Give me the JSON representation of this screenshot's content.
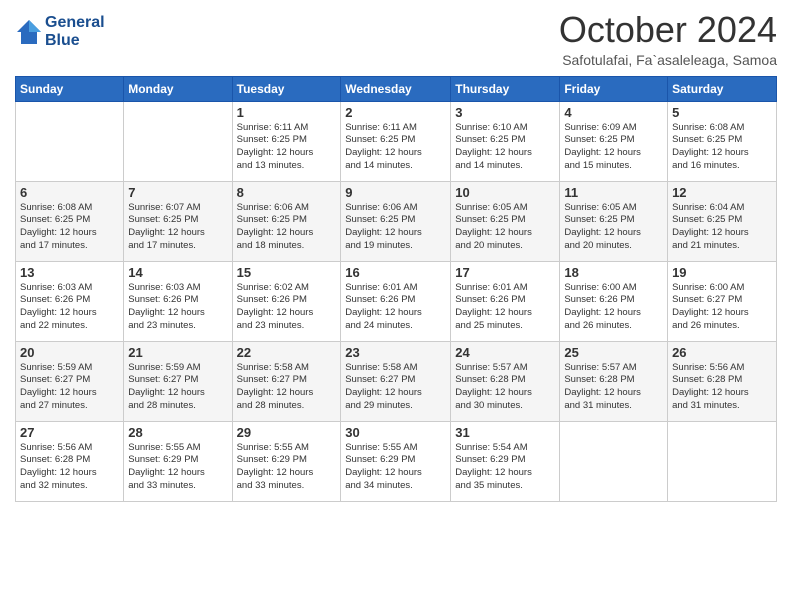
{
  "header": {
    "logo_line1": "General",
    "logo_line2": "Blue",
    "title": "October 2024",
    "location": "Safotulafai, Fa`asaleleaga, Samoa"
  },
  "weekdays": [
    "Sunday",
    "Monday",
    "Tuesday",
    "Wednesday",
    "Thursday",
    "Friday",
    "Saturday"
  ],
  "weeks": [
    [
      {
        "day": "",
        "info": ""
      },
      {
        "day": "",
        "info": ""
      },
      {
        "day": "1",
        "info": "Sunrise: 6:11 AM\nSunset: 6:25 PM\nDaylight: 12 hours\nand 13 minutes."
      },
      {
        "day": "2",
        "info": "Sunrise: 6:11 AM\nSunset: 6:25 PM\nDaylight: 12 hours\nand 14 minutes."
      },
      {
        "day": "3",
        "info": "Sunrise: 6:10 AM\nSunset: 6:25 PM\nDaylight: 12 hours\nand 14 minutes."
      },
      {
        "day": "4",
        "info": "Sunrise: 6:09 AM\nSunset: 6:25 PM\nDaylight: 12 hours\nand 15 minutes."
      },
      {
        "day": "5",
        "info": "Sunrise: 6:08 AM\nSunset: 6:25 PM\nDaylight: 12 hours\nand 16 minutes."
      }
    ],
    [
      {
        "day": "6",
        "info": "Sunrise: 6:08 AM\nSunset: 6:25 PM\nDaylight: 12 hours\nand 17 minutes."
      },
      {
        "day": "7",
        "info": "Sunrise: 6:07 AM\nSunset: 6:25 PM\nDaylight: 12 hours\nand 17 minutes."
      },
      {
        "day": "8",
        "info": "Sunrise: 6:06 AM\nSunset: 6:25 PM\nDaylight: 12 hours\nand 18 minutes."
      },
      {
        "day": "9",
        "info": "Sunrise: 6:06 AM\nSunset: 6:25 PM\nDaylight: 12 hours\nand 19 minutes."
      },
      {
        "day": "10",
        "info": "Sunrise: 6:05 AM\nSunset: 6:25 PM\nDaylight: 12 hours\nand 20 minutes."
      },
      {
        "day": "11",
        "info": "Sunrise: 6:05 AM\nSunset: 6:25 PM\nDaylight: 12 hours\nand 20 minutes."
      },
      {
        "day": "12",
        "info": "Sunrise: 6:04 AM\nSunset: 6:25 PM\nDaylight: 12 hours\nand 21 minutes."
      }
    ],
    [
      {
        "day": "13",
        "info": "Sunrise: 6:03 AM\nSunset: 6:26 PM\nDaylight: 12 hours\nand 22 minutes."
      },
      {
        "day": "14",
        "info": "Sunrise: 6:03 AM\nSunset: 6:26 PM\nDaylight: 12 hours\nand 23 minutes."
      },
      {
        "day": "15",
        "info": "Sunrise: 6:02 AM\nSunset: 6:26 PM\nDaylight: 12 hours\nand 23 minutes."
      },
      {
        "day": "16",
        "info": "Sunrise: 6:01 AM\nSunset: 6:26 PM\nDaylight: 12 hours\nand 24 minutes."
      },
      {
        "day": "17",
        "info": "Sunrise: 6:01 AM\nSunset: 6:26 PM\nDaylight: 12 hours\nand 25 minutes."
      },
      {
        "day": "18",
        "info": "Sunrise: 6:00 AM\nSunset: 6:26 PM\nDaylight: 12 hours\nand 26 minutes."
      },
      {
        "day": "19",
        "info": "Sunrise: 6:00 AM\nSunset: 6:27 PM\nDaylight: 12 hours\nand 26 minutes."
      }
    ],
    [
      {
        "day": "20",
        "info": "Sunrise: 5:59 AM\nSunset: 6:27 PM\nDaylight: 12 hours\nand 27 minutes."
      },
      {
        "day": "21",
        "info": "Sunrise: 5:59 AM\nSunset: 6:27 PM\nDaylight: 12 hours\nand 28 minutes."
      },
      {
        "day": "22",
        "info": "Sunrise: 5:58 AM\nSunset: 6:27 PM\nDaylight: 12 hours\nand 28 minutes."
      },
      {
        "day": "23",
        "info": "Sunrise: 5:58 AM\nSunset: 6:27 PM\nDaylight: 12 hours\nand 29 minutes."
      },
      {
        "day": "24",
        "info": "Sunrise: 5:57 AM\nSunset: 6:28 PM\nDaylight: 12 hours\nand 30 minutes."
      },
      {
        "day": "25",
        "info": "Sunrise: 5:57 AM\nSunset: 6:28 PM\nDaylight: 12 hours\nand 31 minutes."
      },
      {
        "day": "26",
        "info": "Sunrise: 5:56 AM\nSunset: 6:28 PM\nDaylight: 12 hours\nand 31 minutes."
      }
    ],
    [
      {
        "day": "27",
        "info": "Sunrise: 5:56 AM\nSunset: 6:28 PM\nDaylight: 12 hours\nand 32 minutes."
      },
      {
        "day": "28",
        "info": "Sunrise: 5:55 AM\nSunset: 6:29 PM\nDaylight: 12 hours\nand 33 minutes."
      },
      {
        "day": "29",
        "info": "Sunrise: 5:55 AM\nSunset: 6:29 PM\nDaylight: 12 hours\nand 33 minutes."
      },
      {
        "day": "30",
        "info": "Sunrise: 5:55 AM\nSunset: 6:29 PM\nDaylight: 12 hours\nand 34 minutes."
      },
      {
        "day": "31",
        "info": "Sunrise: 5:54 AM\nSunset: 6:29 PM\nDaylight: 12 hours\nand 35 minutes."
      },
      {
        "day": "",
        "info": ""
      },
      {
        "day": "",
        "info": ""
      }
    ]
  ]
}
